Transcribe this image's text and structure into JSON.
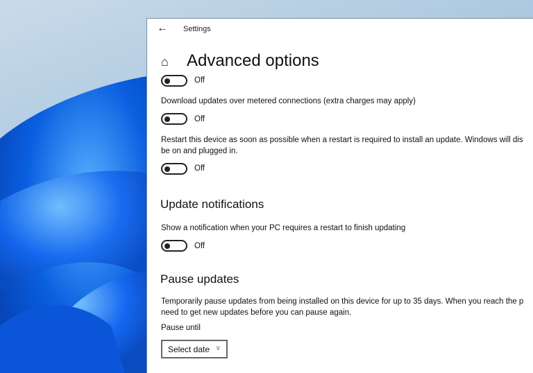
{
  "window": {
    "title": "Settings",
    "back_icon": "arrow-left-icon",
    "home_icon": "home-icon"
  },
  "page": {
    "title": "Advanced options"
  },
  "toggles": [
    {
      "state": "Off"
    },
    {
      "label": "Download updates over metered connections (extra charges may apply)",
      "state": "Off"
    },
    {
      "label": "Restart this device as soon as possible when a restart is required to install an update. Windows will dis",
      "label2": "be on and plugged in.",
      "state": "Off"
    }
  ],
  "notifications": {
    "heading": "Update notifications",
    "label": "Show a notification when your PC requires a restart to finish updating",
    "state": "Off"
  },
  "pause": {
    "heading": "Pause updates",
    "desc1": "Temporarily pause updates from being installed on this device for up to 35 days. When you reach the p",
    "desc2": "need to get new updates before you can pause again.",
    "label": "Pause until",
    "select_value": "Select date"
  }
}
